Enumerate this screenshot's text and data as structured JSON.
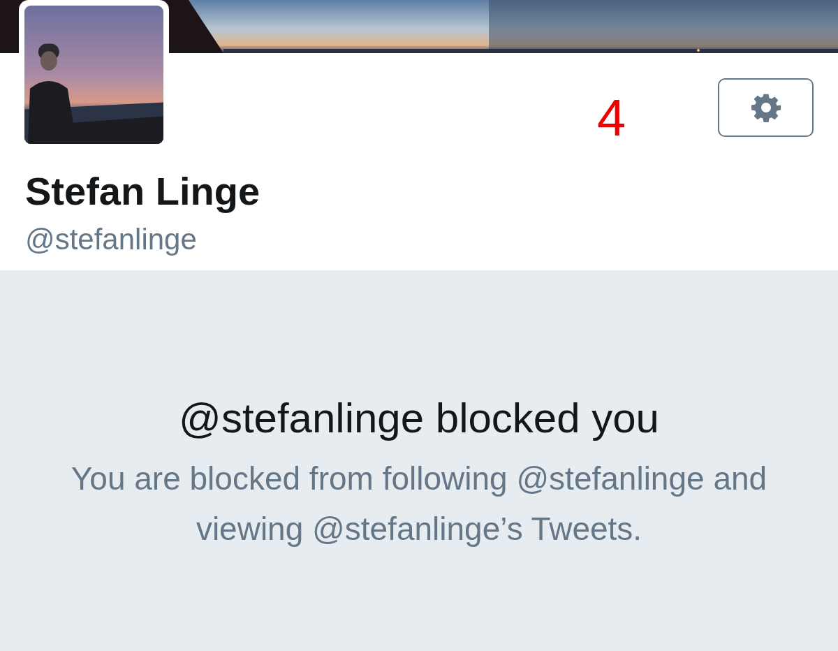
{
  "profile": {
    "annotation": "4",
    "name": "Stefan Linge",
    "handle": "@stefanlinge"
  },
  "blocked_notice": {
    "title": "@stefanlinge blocked you",
    "message": "You are blocked from following @stefanlinge and viewing @stefanlinge’s Tweets."
  }
}
